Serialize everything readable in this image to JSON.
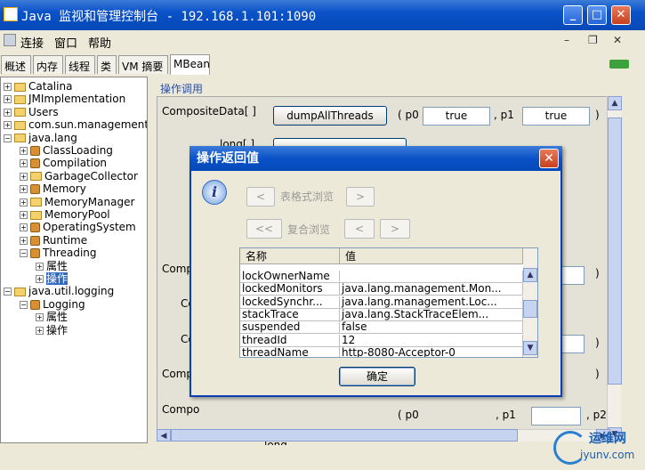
{
  "window": {
    "title": "Java 监视和管理控制台 - 192.168.1.101:1090"
  },
  "menu": {
    "items": [
      "连接",
      "窗口",
      "帮助"
    ]
  },
  "tabs": [
    "概述",
    "内存",
    "线程",
    "类",
    "VM 摘要",
    "MBean"
  ],
  "tree": {
    "nodes": [
      {
        "label": "Catalina",
        "kind": "folder",
        "toggle": "+",
        "indent": 0
      },
      {
        "label": "JMImplementation",
        "kind": "folder",
        "toggle": "+",
        "indent": 0
      },
      {
        "label": "Users",
        "kind": "folder",
        "toggle": "+",
        "indent": 0
      },
      {
        "label": "com.sun.management",
        "kind": "folder",
        "toggle": "+",
        "indent": 0
      },
      {
        "label": "java.lang",
        "kind": "folder",
        "toggle": "−",
        "indent": 0
      },
      {
        "label": "ClassLoading",
        "kind": "bean",
        "toggle": "+",
        "indent": 1
      },
      {
        "label": "Compilation",
        "kind": "bean",
        "toggle": "+",
        "indent": 1
      },
      {
        "label": "GarbageCollector",
        "kind": "folder",
        "toggle": "+",
        "indent": 1
      },
      {
        "label": "Memory",
        "kind": "bean",
        "toggle": "+",
        "indent": 1
      },
      {
        "label": "MemoryManager",
        "kind": "folder",
        "toggle": "+",
        "indent": 1
      },
      {
        "label": "MemoryPool",
        "kind": "folder",
        "toggle": "+",
        "indent": 1
      },
      {
        "label": "OperatingSystem",
        "kind": "bean",
        "toggle": "+",
        "indent": 1
      },
      {
        "label": "Runtime",
        "kind": "bean",
        "toggle": "+",
        "indent": 1
      },
      {
        "label": "Threading",
        "kind": "bean",
        "toggle": "−",
        "indent": 1
      },
      {
        "label": "属性",
        "kind": "none",
        "toggle": "+",
        "indent": 2
      },
      {
        "label": "操作",
        "kind": "none",
        "toggle": "+",
        "indent": 2,
        "selected": true
      },
      {
        "label": "java.util.logging",
        "kind": "folder",
        "toggle": "−",
        "indent": 0
      },
      {
        "label": "Logging",
        "kind": "bean",
        "toggle": "−",
        "indent": 1
      },
      {
        "label": "属性",
        "kind": "none",
        "toggle": "+",
        "indent": 2
      },
      {
        "label": "操作",
        "kind": "none",
        "toggle": "+",
        "indent": 2
      }
    ]
  },
  "operations": {
    "header": "操作调用",
    "first_row": {
      "return_type": "CompositeData[ ]",
      "button": "dumpAllThreads",
      "p0_label": "( p0",
      "p0": "true",
      "p1_label": ", p1",
      "p1": "true",
      "close": ")"
    },
    "partial_labels": [
      "long[ ]",
      "Compo",
      "Co",
      "Co",
      "Compo",
      "Compo",
      "long"
    ],
    "partial_closers": [
      ")",
      ")",
      ")"
    ],
    "partial_params": [
      "( p0",
      ", p1",
      ", p2"
    ]
  },
  "dialog": {
    "title": "操作返回值",
    "table_browse_label": "表格式浏览",
    "composite_browse_label": "复合浏览",
    "prev_symbol": "<",
    "next_symbol": ">",
    "first_symbol": "<<",
    "columns": [
      "名称",
      "值"
    ],
    "rows": [
      {
        "name": "lockOwnerName",
        "value": ""
      },
      {
        "name": "lockedMonitors",
        "value": "java.lang.management.Mon..."
      },
      {
        "name": "lockedSynchr...",
        "value": "java.lang.management.Loc..."
      },
      {
        "name": "stackTrace",
        "value": "java.lang.StackTraceElem..."
      },
      {
        "name": "suspended",
        "value": "false"
      },
      {
        "name": "threadId",
        "value": "12"
      },
      {
        "name": "threadName",
        "value": "http-8080-Acceptor-0"
      }
    ],
    "ok_label": "确定"
  },
  "watermark": {
    "brand": "运维网",
    "url": "iyunv.com"
  }
}
